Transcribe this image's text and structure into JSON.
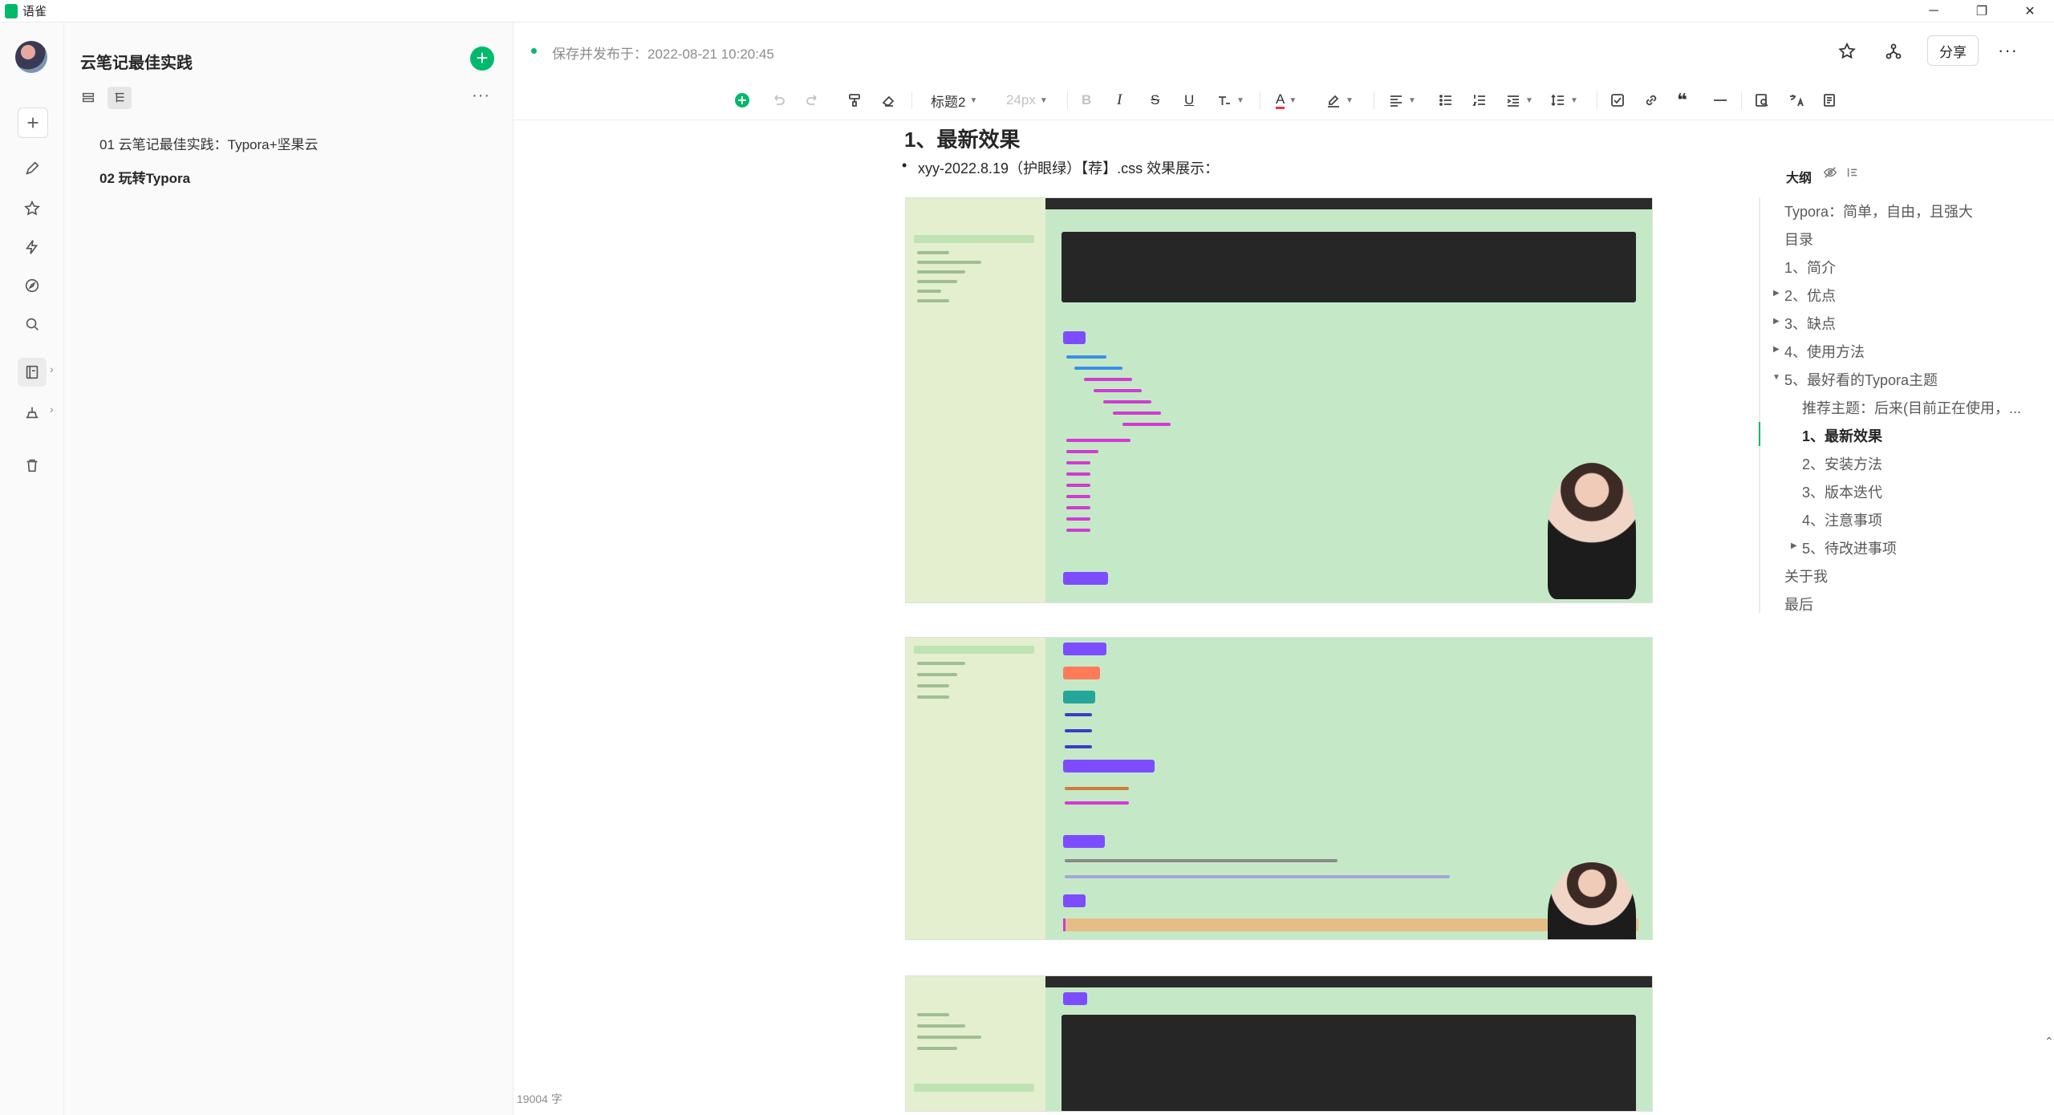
{
  "window": {
    "app_name": "语雀",
    "minimize": "─",
    "restore": "❐",
    "close": "✕"
  },
  "sidebar": {
    "book_title": "云笔记最佳实践",
    "docs": [
      {
        "label": "01 云笔记最佳实践：Typora+坚果云"
      },
      {
        "label": "02 玩转Typora"
      }
    ]
  },
  "header": {
    "save_status": "保存并发布于：2022-08-21 10:20:45",
    "share_label": "分享",
    "more_label": "···"
  },
  "toolbar": {
    "heading_style": "标题2",
    "font_size": "24px",
    "bold": "B",
    "italic": "I",
    "strike": "S",
    "underline": "U",
    "font_color": "A"
  },
  "doc": {
    "heading": "1、最新效果",
    "bullet": "xyy-2022.8.19（护眼绿）【荐】.css 效果展示：",
    "word_count": "19004 字"
  },
  "outline": {
    "title": "大纲",
    "items": [
      {
        "label": "Typora：简单，自由，且强大"
      },
      {
        "label": "目录"
      },
      {
        "label": "1、简介"
      },
      {
        "label": "2、优点"
      },
      {
        "label": "3、缺点"
      },
      {
        "label": "4、使用方法"
      },
      {
        "label": "5、最好看的Typora主题"
      },
      {
        "label": "推荐主题：后来(目前正在使用，..."
      },
      {
        "label": "1、最新效果"
      },
      {
        "label": "2、安装方法"
      },
      {
        "label": "3、版本迭代"
      },
      {
        "label": "4、注意事项"
      },
      {
        "label": "5、待改进事项"
      },
      {
        "label": "关于我"
      },
      {
        "label": "最后"
      }
    ]
  },
  "colors": {
    "accent": "#00b96b",
    "theme_green": "#c5e9c7"
  }
}
